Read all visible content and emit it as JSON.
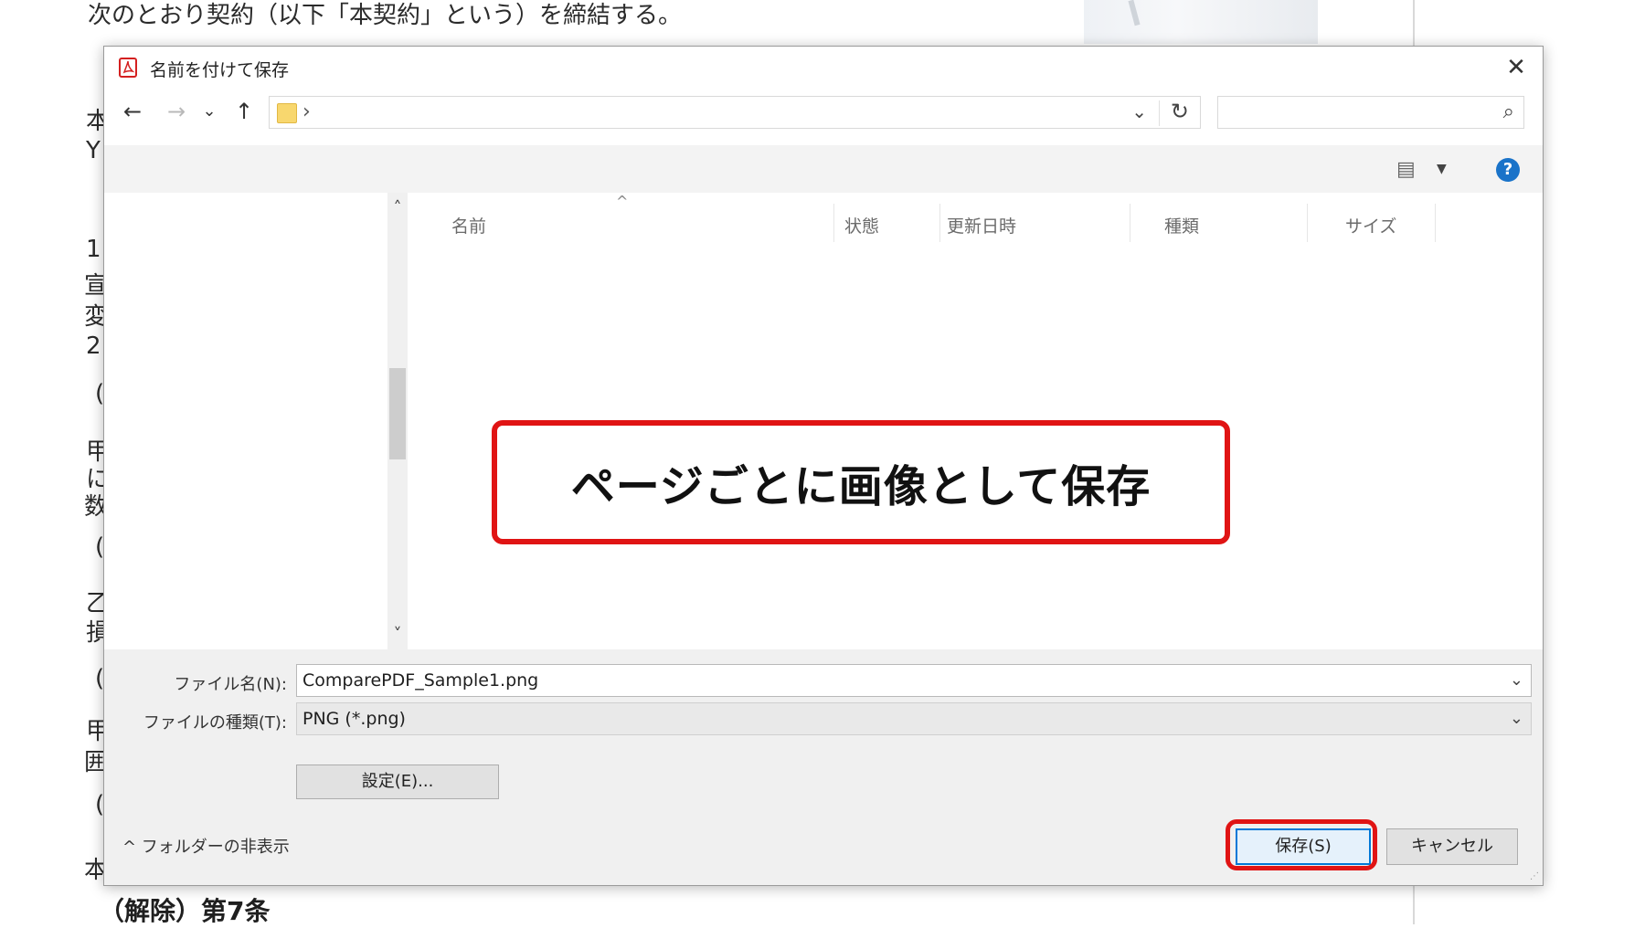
{
  "background_doc": {
    "top_line": "次のとおり契約（以下「本契約」という）を締結する。",
    "left_fragments": [
      "本",
      "Y",
      "1",
      "宣",
      "変",
      "2",
      "(",
      "甲",
      "に",
      "数",
      "(",
      "乙",
      "損",
      "(",
      "甲",
      "囲",
      "(",
      "本"
    ],
    "heading": "（解除）第7条"
  },
  "dialog": {
    "title": "名前を付けて保存",
    "close_symbol": "✕",
    "nav": {
      "back": "←",
      "forward": "→",
      "recent": "⌄",
      "up": "↑"
    },
    "address": {
      "chevron": "›",
      "dropdown": "⌄",
      "refresh": "↻"
    },
    "search": {
      "placeholder": "",
      "icon": "⌕"
    },
    "toolbar": {
      "view_icon": "▤",
      "view_dropdown": "▼",
      "help_symbol": "?"
    },
    "columns": [
      {
        "label": "名前"
      },
      {
        "label": "状態"
      },
      {
        "label": "更新日時"
      },
      {
        "label": "種類"
      },
      {
        "label": "サイズ"
      }
    ],
    "sort_caret": "^",
    "scroll": {
      "up": "˄",
      "down": "˅"
    },
    "callout_text": "ページごとに画像として保存",
    "filename_label": "ファイル名(N):",
    "filename_value": "ComparePDF_Sample1.png",
    "filetype_label": "ファイルの種類(T):",
    "filetype_value": "PNG (*.png)",
    "dropdown_symbol": "⌄",
    "settings_button": "設定(E)...",
    "hide_folders": "^ フォルダーの非表示",
    "save_button": "保存(S)",
    "cancel_button": "キャンセル"
  },
  "colors": {
    "accent": "#0078d7",
    "highlight": "#e01414",
    "help": "#1a73c9"
  }
}
